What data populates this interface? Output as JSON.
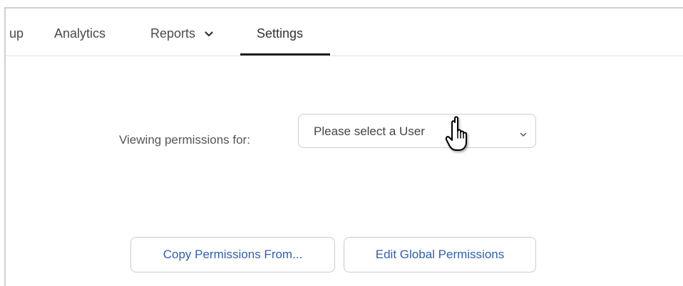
{
  "nav": {
    "tabs": [
      {
        "label": "up",
        "active": false
      },
      {
        "label": "Analytics",
        "active": false
      },
      {
        "label": "Reports",
        "active": false,
        "has_dropdown": true
      },
      {
        "label": "Settings",
        "active": true
      }
    ]
  },
  "permissions": {
    "label": "Viewing permissions for:",
    "user_select": {
      "value": "Please select a User"
    }
  },
  "actions": {
    "copy_label": "Copy Permissions From...",
    "global_label": "Edit Global Permissions"
  },
  "colors": {
    "link_blue": "#2f5fb3",
    "active_underline": "#222222",
    "border": "#cccccc"
  },
  "icons": {
    "reports_dropdown": "chevron-down-icon",
    "select_dropdown": "chevron-down-icon",
    "cursor": "hand-pointer-cursor-icon"
  }
}
